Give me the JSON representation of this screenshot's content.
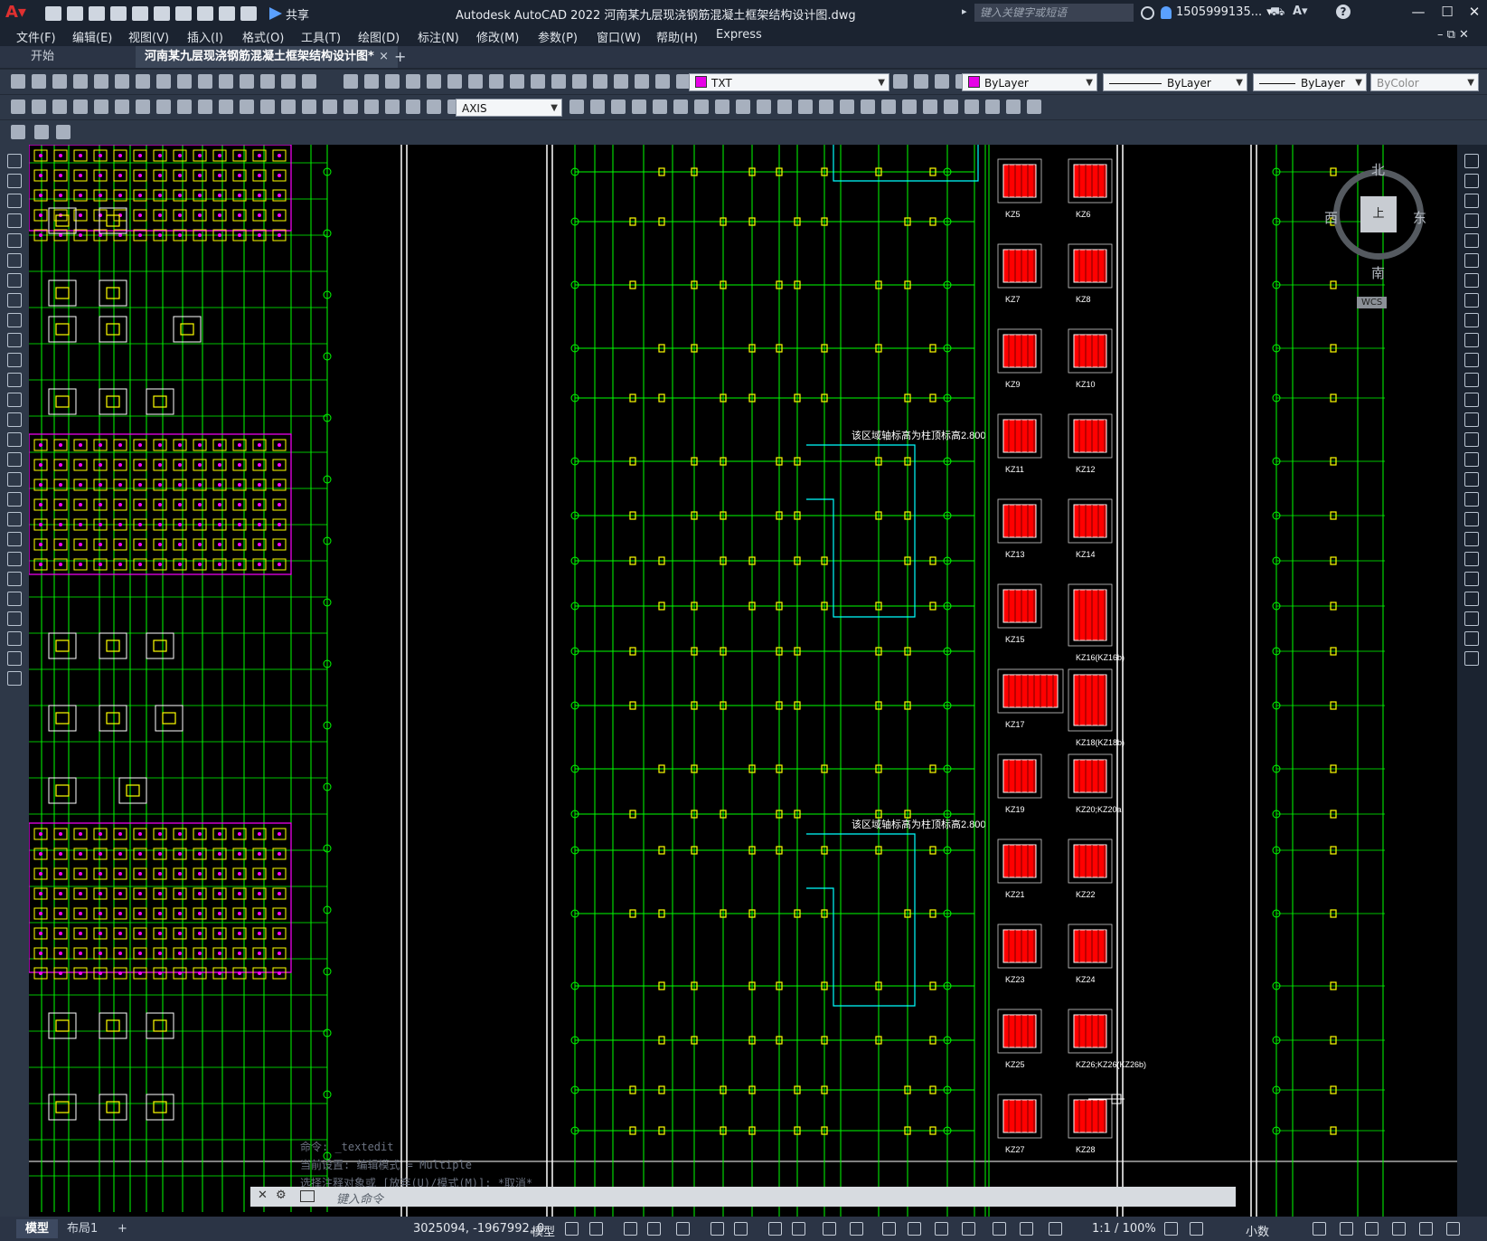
{
  "titlebar": {
    "share_label": "共享",
    "title": "Autodesk AutoCAD 2022    河南某九层现浇钢筋混凝土框架结构设计图.dwg",
    "search_placeholder": "键入关键字或短语",
    "username": "1505999135..."
  },
  "menu": [
    {
      "label": "文件(F)"
    },
    {
      "label": "编辑(E)"
    },
    {
      "label": "视图(V)"
    },
    {
      "label": "插入(I)"
    },
    {
      "label": "格式(O)"
    },
    {
      "label": "工具(T)"
    },
    {
      "label": "绘图(D)"
    },
    {
      "label": "标注(N)"
    },
    {
      "label": "修改(M)"
    },
    {
      "label": "参数(P)"
    },
    {
      "label": "窗口(W)"
    },
    {
      "label": "帮助(H)"
    },
    {
      "label": "Express"
    }
  ],
  "tabs": {
    "start": "开始",
    "active": "河南某九层现浇钢筋混凝土框架结构设计图*",
    "close": "×",
    "add": "+"
  },
  "toolbar": {
    "layer": "TXT",
    "color": "ByLayer",
    "linetype": "ByLayer",
    "lineweight": "ByLayer",
    "plotstyle": "ByColor",
    "dimstyle": "AXIS"
  },
  "viewcube": {
    "north": "北",
    "south": "南",
    "east": "东",
    "west": "西",
    "top": "上",
    "wcs": "WCS"
  },
  "drawing": {
    "col_labels": [
      "KZ5",
      "KZ6",
      "KZ7",
      "KZ8",
      "KZ9",
      "KZ10",
      "KZ11",
      "KZ12",
      "KZ13",
      "KZ14",
      "KZ15",
      "KZ16(KZ16b)",
      "KZ17",
      "KZ18(KZ18b)",
      "KZ19",
      "KZ20;KZ20a",
      "KZ21",
      "KZ22",
      "KZ23",
      "KZ24",
      "KZ25",
      "KZ26;KZ26(KZ26b)",
      "KZ27",
      "KZ28"
    ],
    "note_1": "该区域轴标高为柱顶标高2.800",
    "note_2": "该区域轴标高为柱顶标高2.800"
  },
  "command": {
    "history": [
      "命令: _textedit",
      "当前设置: 编辑模式 = Multiple",
      "选择注释对象或 [放弃(U)/模式(M)]: *取消*"
    ],
    "placeholder": "键入命令"
  },
  "status": {
    "tab_model": "模型",
    "tab_layout": "布局1",
    "tab_add": "+",
    "coords": "3025094, -1967992, 0",
    "model_label": "模型",
    "scale": "1:1 / 100%",
    "units": "小数"
  },
  "colors": {
    "bg": "#000000",
    "axis": "#00ff00",
    "column": "#ffff00",
    "rebar": "#ff0000",
    "magenta": "#ff00ff",
    "cyan": "#00ffff"
  }
}
